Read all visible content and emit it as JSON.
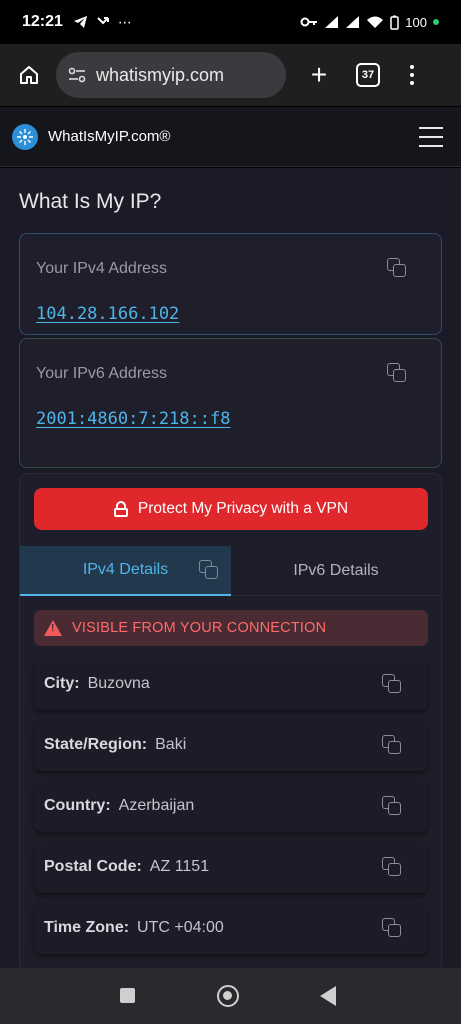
{
  "status_bar": {
    "time": "12:21",
    "left_icons": [
      "telegram-icon",
      "missed-call-icon",
      "more-icon"
    ],
    "more_label": "⋯",
    "right_icons": [
      "vpn-key-icon",
      "signal-icon",
      "signal-icon",
      "wifi-icon",
      "battery-icon"
    ],
    "battery": "100"
  },
  "browser": {
    "url": "whatismyip.com",
    "tab_count": "37",
    "new_tab_label": "+"
  },
  "site": {
    "name": "WhatIsMyIP.com®"
  },
  "page": {
    "title": "What Is My IP?"
  },
  "ipv4": {
    "label": "Your IPv4 Address",
    "value": "104.28.166.102"
  },
  "ipv6": {
    "label": "Your IPv6 Address",
    "value": "2001:4860:7:218::f8"
  },
  "vpn_button": {
    "label": "Protect My Privacy with a VPN",
    "color": "#e0282c"
  },
  "tabs": [
    {
      "label": "IPv4 Details",
      "active": true
    },
    {
      "label": "IPv6 Details",
      "active": false
    }
  ],
  "warning": {
    "text": "VISIBLE FROM YOUR CONNECTION"
  },
  "details": [
    {
      "key": "City:",
      "value": "Buzovna"
    },
    {
      "key": "State/Region:",
      "value": "Baki"
    },
    {
      "key": "Country:",
      "value": "Azerbaijan"
    },
    {
      "key": "Postal Code:",
      "value": "AZ 1151"
    },
    {
      "key": "Time Zone:",
      "value": "UTC +04:00"
    }
  ],
  "colors": {
    "accent": "#4fb4e8",
    "warning": "#ff6b6b",
    "background": "#1b1b27"
  }
}
